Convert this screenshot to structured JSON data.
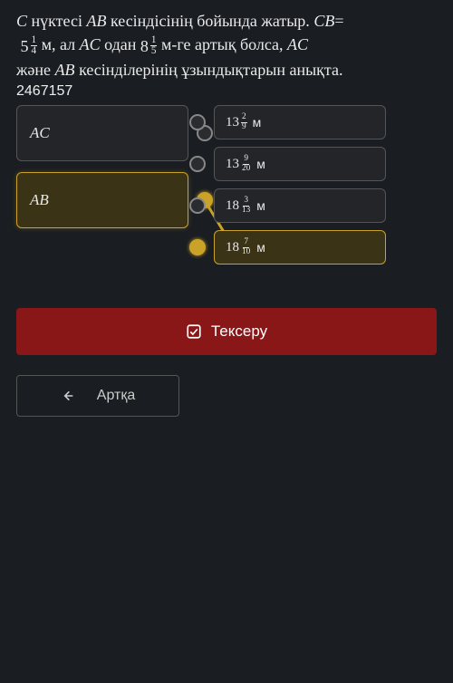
{
  "problem": {
    "p1a": "C",
    "p1b": " нүктесі ",
    "p1c": "AB",
    "p1d": " кесіндісінің бойында жатыр. ",
    "p1e": "CB",
    "p1f": "=",
    "mix1": {
      "whole": "5",
      "num": "1",
      "den": "4"
    },
    "p2a": " м, ал ",
    "p2b": "AC",
    "p2c": " одан  ",
    "mix2": {
      "whole": "8",
      "num": "1",
      "den": "5"
    },
    "p2d": " м-ге артық болса, ",
    "p2e": "AC",
    "p3a": "және ",
    "p3b": "AB",
    "p3c": " кесінділерінің ұзындықтарын анықта."
  },
  "code": "2467157",
  "lefts": [
    {
      "label": "AC",
      "selected": false
    },
    {
      "label": "AB",
      "selected": true
    }
  ],
  "rights": [
    {
      "whole": "13",
      "num": "2",
      "den": "9",
      "unit": "м",
      "selected": false
    },
    {
      "whole": "13",
      "num": "9",
      "den": "20",
      "unit": "м",
      "selected": false
    },
    {
      "whole": "18",
      "num": "3",
      "den": "13",
      "unit": "м",
      "selected": false
    },
    {
      "whole": "18",
      "num": "7",
      "den": "10",
      "unit": "м",
      "selected": true
    }
  ],
  "buttons": {
    "check": "Тексеру",
    "back": "Артқа"
  }
}
